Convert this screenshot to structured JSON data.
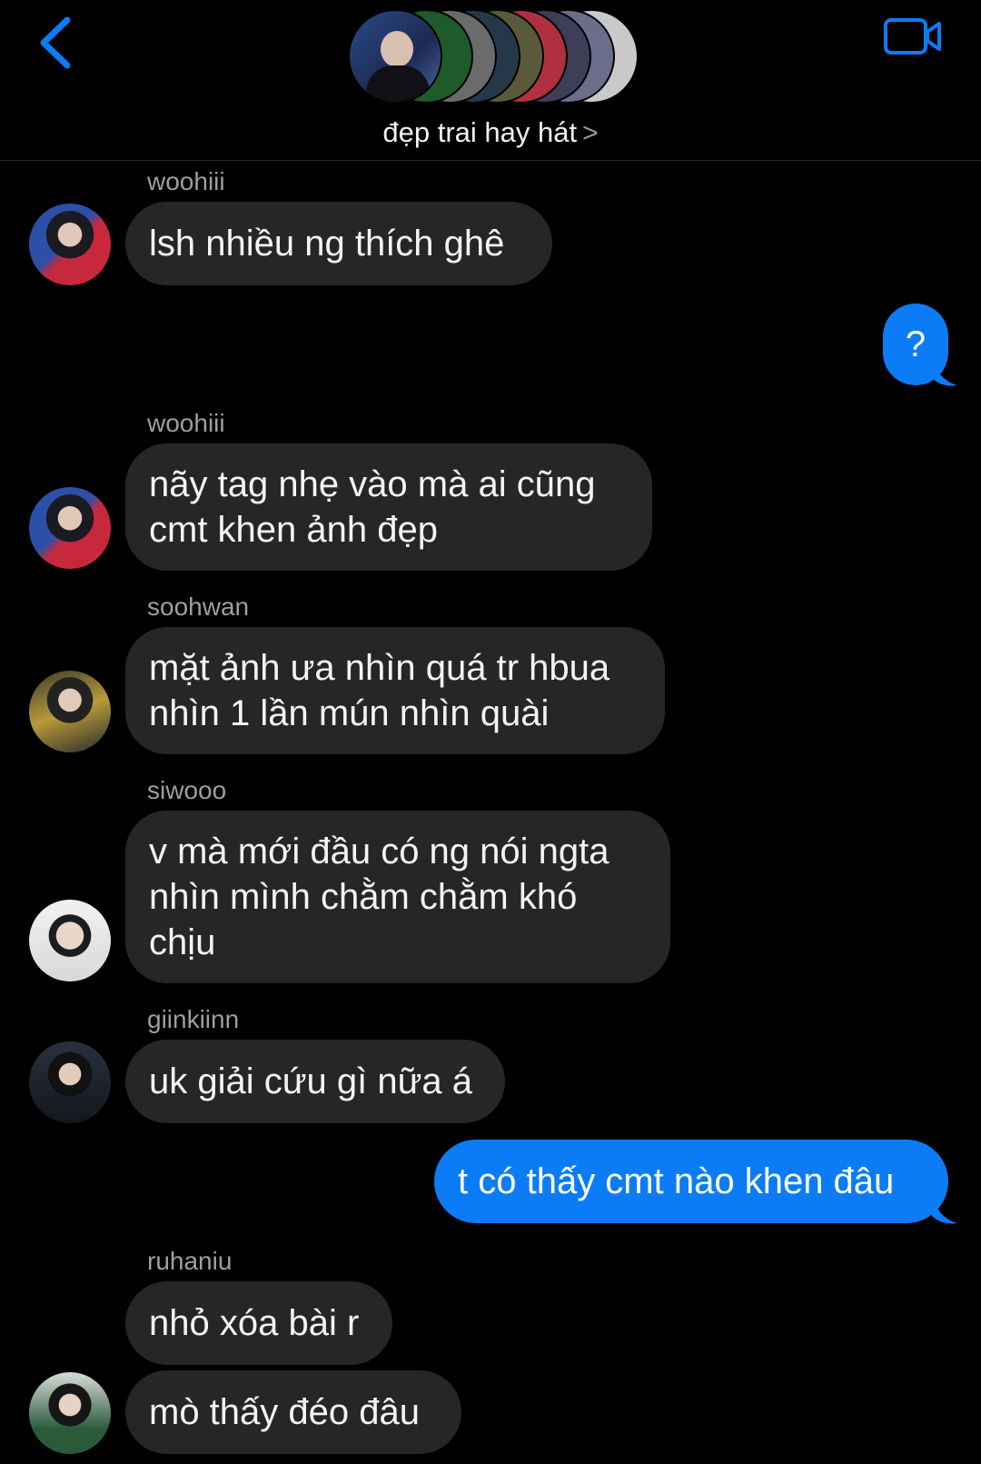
{
  "header": {
    "group_name": "đẹp trai hay hát",
    "chevron": ">",
    "back_icon": "chevron-left-icon",
    "video_icon": "video-call-icon",
    "accent": "#0b7cf5"
  },
  "messages": [
    {
      "sender": "woohiii",
      "text": "lsh nhiều ng thích ghê"
    },
    {
      "sender": "me",
      "text": "?"
    },
    {
      "sender": "woohiii",
      "text": "nãy tag nhẹ vào mà ai cũng cmt khen ảnh đẹp"
    },
    {
      "sender": "soohwan",
      "text": "mặt ảnh ưa nhìn quá tr hbua nhìn 1 lần mún nhìn quài"
    },
    {
      "sender": "siwooo",
      "text": "v mà mới đầu có ng nói ngta nhìn mình chằm chằm khó chịu"
    },
    {
      "sender": "giinkiinn",
      "text": "uk giải cứu gì nữa á"
    },
    {
      "sender": "me",
      "text": "t có thấy cmt nào khen đâu"
    },
    {
      "sender": "ruhaniu",
      "text": "nhỏ xóa bài r"
    },
    {
      "sender": "ruhaniu",
      "text": "mò thấy đéo đâu"
    }
  ]
}
